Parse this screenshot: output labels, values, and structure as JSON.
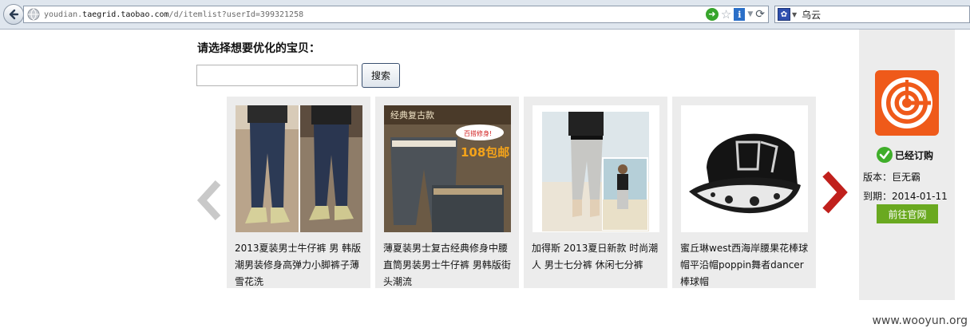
{
  "browser": {
    "url_prefix": "youdian.",
    "url_domain": "taegrid.taobao.com",
    "url_path": "/d/itemlist?userId=399321258",
    "search_text": "乌云",
    "icons": [
      "back-icon",
      "globe-icon",
      "go-icon",
      "star-icon",
      "info-icon",
      "dropdown-icon",
      "reload-icon",
      "search-engine-icon"
    ]
  },
  "page": {
    "heading": "请选择想要优化的宝贝：",
    "search_input_value": "",
    "search_button": "搜索"
  },
  "products": [
    {
      "title": "2013夏装男士牛仔裤 男 韩版潮男装修身高弹力小脚裤子薄雪花洗"
    },
    {
      "title": "薄夏装男士复古经典修身中腰直筒男装男士牛仔裤 男韩版街头潮流",
      "badge_top": "经典复古款",
      "badge_bubble": "百搭修身!",
      "badge_price": "108包邮"
    },
    {
      "title": "加得斯 2013夏日新款 时尚潮人 男士七分裤 休闲七分裤"
    },
    {
      "title": "蜜丘琳west西海岸腰果花棒球帽平沿帽poppin舞者dancer棒球帽"
    }
  ],
  "sidebar": {
    "status": "已经订购",
    "version_line": "版本：巨无霸",
    "expiry_line": "到期：2014-01-11",
    "site_button": "前往官网"
  },
  "watermark": "www.wooyun.org",
  "colors": {
    "accent_green": "#6aa920",
    "arrow_red": "#c0201c",
    "logo_orange": "#ef5a1a"
  }
}
